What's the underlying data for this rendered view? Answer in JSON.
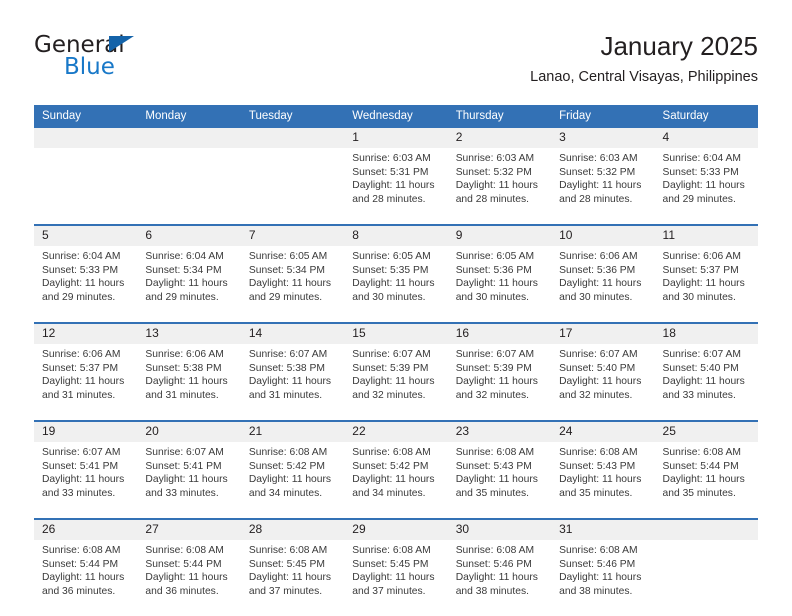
{
  "brand": {
    "name_top": "General",
    "name_bottom": "Blue",
    "triangle_icon": "triangle-icon",
    "color_dark": "#231f20",
    "color_blue": "#1878c8"
  },
  "header": {
    "title": "January 2025",
    "subtitle": "Lanao, Central Visayas, Philippines"
  },
  "theme": {
    "header_bg": "#3371b5",
    "header_text": "#ffffff",
    "daynum_bg": "#f0f0f0",
    "cell_bg": "#ffffff",
    "body_text": "#3a3a3a"
  },
  "weekday_headers": [
    "Sunday",
    "Monday",
    "Tuesday",
    "Wednesday",
    "Thursday",
    "Friday",
    "Saturday"
  ],
  "weeks": [
    {
      "days": [
        {
          "date": "",
          "sunrise": "",
          "sunset": "",
          "daylight_line1": "",
          "daylight_line2": ""
        },
        {
          "date": "",
          "sunrise": "",
          "sunset": "",
          "daylight_line1": "",
          "daylight_line2": ""
        },
        {
          "date": "",
          "sunrise": "",
          "sunset": "",
          "daylight_line1": "",
          "daylight_line2": ""
        },
        {
          "date": "1",
          "sunrise": "Sunrise: 6:03 AM",
          "sunset": "Sunset: 5:31 PM",
          "daylight_line1": "Daylight: 11 hours",
          "daylight_line2": "and 28 minutes."
        },
        {
          "date": "2",
          "sunrise": "Sunrise: 6:03 AM",
          "sunset": "Sunset: 5:32 PM",
          "daylight_line1": "Daylight: 11 hours",
          "daylight_line2": "and 28 minutes."
        },
        {
          "date": "3",
          "sunrise": "Sunrise: 6:03 AM",
          "sunset": "Sunset: 5:32 PM",
          "daylight_line1": "Daylight: 11 hours",
          "daylight_line2": "and 28 minutes."
        },
        {
          "date": "4",
          "sunrise": "Sunrise: 6:04 AM",
          "sunset": "Sunset: 5:33 PM",
          "daylight_line1": "Daylight: 11 hours",
          "daylight_line2": "and 29 minutes."
        }
      ]
    },
    {
      "days": [
        {
          "date": "5",
          "sunrise": "Sunrise: 6:04 AM",
          "sunset": "Sunset: 5:33 PM",
          "daylight_line1": "Daylight: 11 hours",
          "daylight_line2": "and 29 minutes."
        },
        {
          "date": "6",
          "sunrise": "Sunrise: 6:04 AM",
          "sunset": "Sunset: 5:34 PM",
          "daylight_line1": "Daylight: 11 hours",
          "daylight_line2": "and 29 minutes."
        },
        {
          "date": "7",
          "sunrise": "Sunrise: 6:05 AM",
          "sunset": "Sunset: 5:34 PM",
          "daylight_line1": "Daylight: 11 hours",
          "daylight_line2": "and 29 minutes."
        },
        {
          "date": "8",
          "sunrise": "Sunrise: 6:05 AM",
          "sunset": "Sunset: 5:35 PM",
          "daylight_line1": "Daylight: 11 hours",
          "daylight_line2": "and 30 minutes."
        },
        {
          "date": "9",
          "sunrise": "Sunrise: 6:05 AM",
          "sunset": "Sunset: 5:36 PM",
          "daylight_line1": "Daylight: 11 hours",
          "daylight_line2": "and 30 minutes."
        },
        {
          "date": "10",
          "sunrise": "Sunrise: 6:06 AM",
          "sunset": "Sunset: 5:36 PM",
          "daylight_line1": "Daylight: 11 hours",
          "daylight_line2": "and 30 minutes."
        },
        {
          "date": "11",
          "sunrise": "Sunrise: 6:06 AM",
          "sunset": "Sunset: 5:37 PM",
          "daylight_line1": "Daylight: 11 hours",
          "daylight_line2": "and 30 minutes."
        }
      ]
    },
    {
      "days": [
        {
          "date": "12",
          "sunrise": "Sunrise: 6:06 AM",
          "sunset": "Sunset: 5:37 PM",
          "daylight_line1": "Daylight: 11 hours",
          "daylight_line2": "and 31 minutes."
        },
        {
          "date": "13",
          "sunrise": "Sunrise: 6:06 AM",
          "sunset": "Sunset: 5:38 PM",
          "daylight_line1": "Daylight: 11 hours",
          "daylight_line2": "and 31 minutes."
        },
        {
          "date": "14",
          "sunrise": "Sunrise: 6:07 AM",
          "sunset": "Sunset: 5:38 PM",
          "daylight_line1": "Daylight: 11 hours",
          "daylight_line2": "and 31 minutes."
        },
        {
          "date": "15",
          "sunrise": "Sunrise: 6:07 AM",
          "sunset": "Sunset: 5:39 PM",
          "daylight_line1": "Daylight: 11 hours",
          "daylight_line2": "and 32 minutes."
        },
        {
          "date": "16",
          "sunrise": "Sunrise: 6:07 AM",
          "sunset": "Sunset: 5:39 PM",
          "daylight_line1": "Daylight: 11 hours",
          "daylight_line2": "and 32 minutes."
        },
        {
          "date": "17",
          "sunrise": "Sunrise: 6:07 AM",
          "sunset": "Sunset: 5:40 PM",
          "daylight_line1": "Daylight: 11 hours",
          "daylight_line2": "and 32 minutes."
        },
        {
          "date": "18",
          "sunrise": "Sunrise: 6:07 AM",
          "sunset": "Sunset: 5:40 PM",
          "daylight_line1": "Daylight: 11 hours",
          "daylight_line2": "and 33 minutes."
        }
      ]
    },
    {
      "days": [
        {
          "date": "19",
          "sunrise": "Sunrise: 6:07 AM",
          "sunset": "Sunset: 5:41 PM",
          "daylight_line1": "Daylight: 11 hours",
          "daylight_line2": "and 33 minutes."
        },
        {
          "date": "20",
          "sunrise": "Sunrise: 6:07 AM",
          "sunset": "Sunset: 5:41 PM",
          "daylight_line1": "Daylight: 11 hours",
          "daylight_line2": "and 33 minutes."
        },
        {
          "date": "21",
          "sunrise": "Sunrise: 6:08 AM",
          "sunset": "Sunset: 5:42 PM",
          "daylight_line1": "Daylight: 11 hours",
          "daylight_line2": "and 34 minutes."
        },
        {
          "date": "22",
          "sunrise": "Sunrise: 6:08 AM",
          "sunset": "Sunset: 5:42 PM",
          "daylight_line1": "Daylight: 11 hours",
          "daylight_line2": "and 34 minutes."
        },
        {
          "date": "23",
          "sunrise": "Sunrise: 6:08 AM",
          "sunset": "Sunset: 5:43 PM",
          "daylight_line1": "Daylight: 11 hours",
          "daylight_line2": "and 35 minutes."
        },
        {
          "date": "24",
          "sunrise": "Sunrise: 6:08 AM",
          "sunset": "Sunset: 5:43 PM",
          "daylight_line1": "Daylight: 11 hours",
          "daylight_line2": "and 35 minutes."
        },
        {
          "date": "25",
          "sunrise": "Sunrise: 6:08 AM",
          "sunset": "Sunset: 5:44 PM",
          "daylight_line1": "Daylight: 11 hours",
          "daylight_line2": "and 35 minutes."
        }
      ]
    },
    {
      "days": [
        {
          "date": "26",
          "sunrise": "Sunrise: 6:08 AM",
          "sunset": "Sunset: 5:44 PM",
          "daylight_line1": "Daylight: 11 hours",
          "daylight_line2": "and 36 minutes."
        },
        {
          "date": "27",
          "sunrise": "Sunrise: 6:08 AM",
          "sunset": "Sunset: 5:44 PM",
          "daylight_line1": "Daylight: 11 hours",
          "daylight_line2": "and 36 minutes."
        },
        {
          "date": "28",
          "sunrise": "Sunrise: 6:08 AM",
          "sunset": "Sunset: 5:45 PM",
          "daylight_line1": "Daylight: 11 hours",
          "daylight_line2": "and 37 minutes."
        },
        {
          "date": "29",
          "sunrise": "Sunrise: 6:08 AM",
          "sunset": "Sunset: 5:45 PM",
          "daylight_line1": "Daylight: 11 hours",
          "daylight_line2": "and 37 minutes."
        },
        {
          "date": "30",
          "sunrise": "Sunrise: 6:08 AM",
          "sunset": "Sunset: 5:46 PM",
          "daylight_line1": "Daylight: 11 hours",
          "daylight_line2": "and 38 minutes."
        },
        {
          "date": "31",
          "sunrise": "Sunrise: 6:08 AM",
          "sunset": "Sunset: 5:46 PM",
          "daylight_line1": "Daylight: 11 hours",
          "daylight_line2": "and 38 minutes."
        },
        {
          "date": "",
          "sunrise": "",
          "sunset": "",
          "daylight_line1": "",
          "daylight_line2": ""
        }
      ]
    }
  ]
}
